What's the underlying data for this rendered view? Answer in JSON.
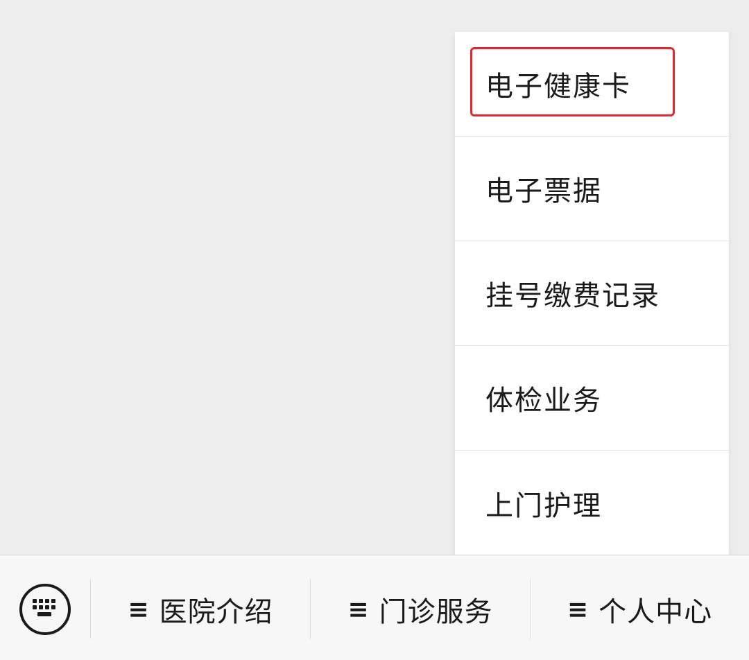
{
  "popup_menu": {
    "items": [
      {
        "label": "电子健康卡"
      },
      {
        "label": "电子票据"
      },
      {
        "label": "挂号缴费记录"
      },
      {
        "label": "体检业务"
      },
      {
        "label": "上门护理"
      }
    ],
    "highlight_color": "#e8252a"
  },
  "bottom_bar": {
    "keyboard_icon": "keyboard-icon",
    "tabs": [
      {
        "icon": "≡",
        "label": "医院介绍"
      },
      {
        "icon": "≡",
        "label": "门诊服务"
      },
      {
        "icon": "≡",
        "label": "个人中心"
      }
    ]
  }
}
